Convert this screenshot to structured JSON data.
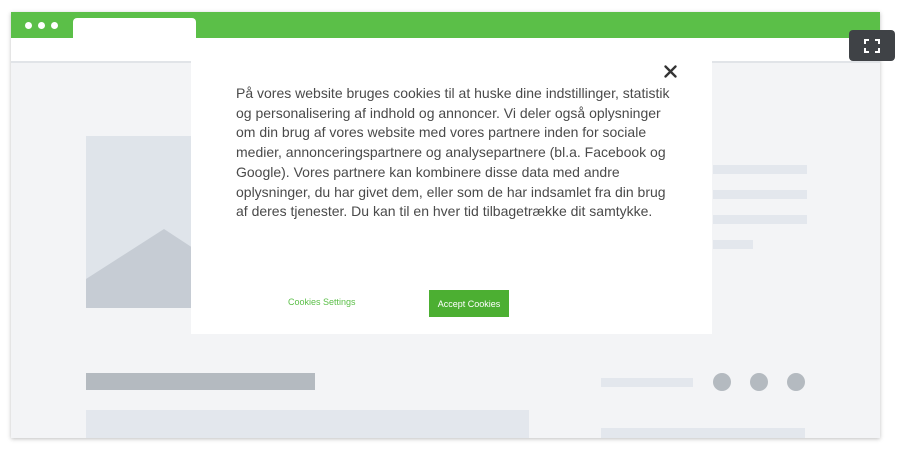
{
  "colors": {
    "brand_green": "#5bbf48",
    "button_green": "#4caf32",
    "text": "#4a4a4a",
    "placeholder_light": "#e3e7ed",
    "placeholder_dark": "#b4bac0",
    "fullscreen_bg": "#3f4246"
  },
  "icons": {
    "close": "close-icon",
    "fullscreen": "fullscreen-icon"
  },
  "cookie_dialog": {
    "message": "På vores website bruges cookies til at huske dine indstillinger, statistik og personalisering af indhold og annoncer. Vi deler også oplysninger om din brug af vores website med vores partnere inden for sociale medier, annonceringspartnere og analysepartnere (bl.a. Facebook og Google). Vores partnere kan kombinere disse data med andre oplysninger, du har givet dem, eller som de har indsamlet fra din brug af deres tjenester. Du kan til en hver tid tilbagetrække dit samtykke.",
    "settings_label": "Cookies Settings",
    "accept_label": "Accept Cookies"
  }
}
